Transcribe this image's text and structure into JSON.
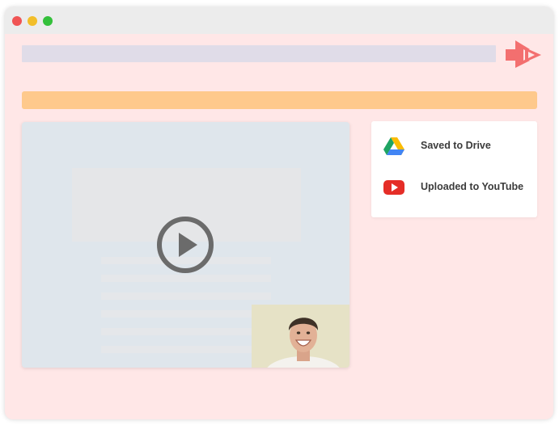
{
  "window": {
    "controls": [
      "close",
      "minimize",
      "maximize"
    ],
    "logo_icon": "brand-arrows-logo-icon"
  },
  "video": {
    "play_icon": "play-icon",
    "webcam_icon": "person-avatar-icon"
  },
  "status": {
    "items": [
      {
        "icon": "google-drive-icon",
        "label": "Saved to Drive"
      },
      {
        "icon": "youtube-icon",
        "label": "Uploaded to YouTube"
      }
    ]
  },
  "colors": {
    "page_bg": "#ffe7e7",
    "titlebar": "#ececec",
    "close": "#f05454",
    "minimize": "#f2be2a",
    "maximize": "#34c03b",
    "address_bar": "#e0dce8",
    "banner": "#fec98c",
    "logo": "#f36f6f",
    "video_bg": "#dfe6ec",
    "youtube_red": "#e52d27"
  }
}
